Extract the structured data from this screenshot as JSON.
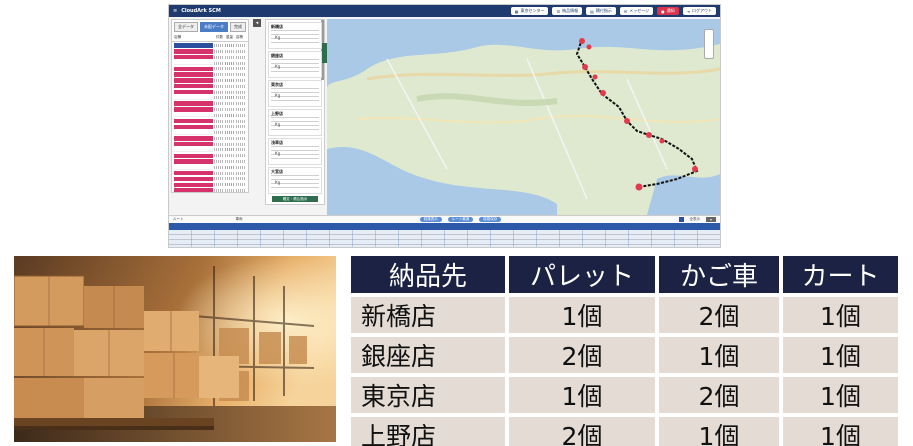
{
  "app": {
    "logo": "CloudArk SCM",
    "top_buttons": [
      {
        "label": "東京センター",
        "icon": "building-icon"
      },
      {
        "label": "納品情報",
        "icon": "list-icon"
      },
      {
        "label": "積付指示",
        "icon": "grid-icon"
      },
      {
        "label": "メッセージ",
        "icon": "mail-icon"
      },
      {
        "label": "通知",
        "icon": "bell-icon"
      },
      {
        "label": "ログアウト",
        "icon": "logout-icon"
      }
    ],
    "left_tabs": [
      "全データ",
      "未配データ",
      "完成"
    ],
    "left_headers": [
      "店舗",
      "件数",
      "重量",
      "容積"
    ],
    "left_rows": [
      "h",
      "p",
      "p",
      "w",
      "p",
      "p",
      "p",
      "p",
      "p",
      "w",
      "p",
      "p",
      "w",
      "p",
      "p",
      "w",
      "p",
      "p",
      "w",
      "p",
      "p",
      "w",
      "p",
      "p",
      "p",
      "p",
      "w",
      "p",
      "w",
      "p",
      "p"
    ],
    "cards": [
      {
        "title": "新橋店",
        "unit": "Kg"
      },
      {
        "title": "銀座店",
        "unit": "Kg"
      },
      {
        "title": "東京店",
        "unit": "Kg"
      },
      {
        "title": "上野店",
        "unit": "Kg"
      },
      {
        "title": "浅草店",
        "unit": "Kg"
      },
      {
        "title": "大宮店",
        "unit": "Kg"
      }
    ],
    "cards_button": "確定・積込指示",
    "bottom": {
      "left_label": "ルート",
      "mid_label": "車両",
      "pills": [
        "経路表示",
        "ルート最適",
        "経路保存"
      ],
      "toggle_label": "全表示"
    },
    "colors": {
      "header": "#1e3a6e",
      "pink": "#d6336c",
      "grid": "#2d5aa8"
    }
  },
  "table": {
    "headers": [
      "納品先",
      "パレット",
      "かご車",
      "カート"
    ],
    "rows": [
      {
        "store": "新橋店",
        "pallet": "1個",
        "cage": "2個",
        "cart": "1個"
      },
      {
        "store": "銀座店",
        "pallet": "2個",
        "cage": "1個",
        "cart": "1個"
      },
      {
        "store": "東京店",
        "pallet": "1個",
        "cage": "2個",
        "cart": "1個"
      },
      {
        "store": "上野店",
        "pallet": "2個",
        "cage": "1個",
        "cart": "1個"
      }
    ],
    "colors": {
      "header_bg": "#1b2244",
      "cell_bg": "#e3dbd4"
    }
  }
}
